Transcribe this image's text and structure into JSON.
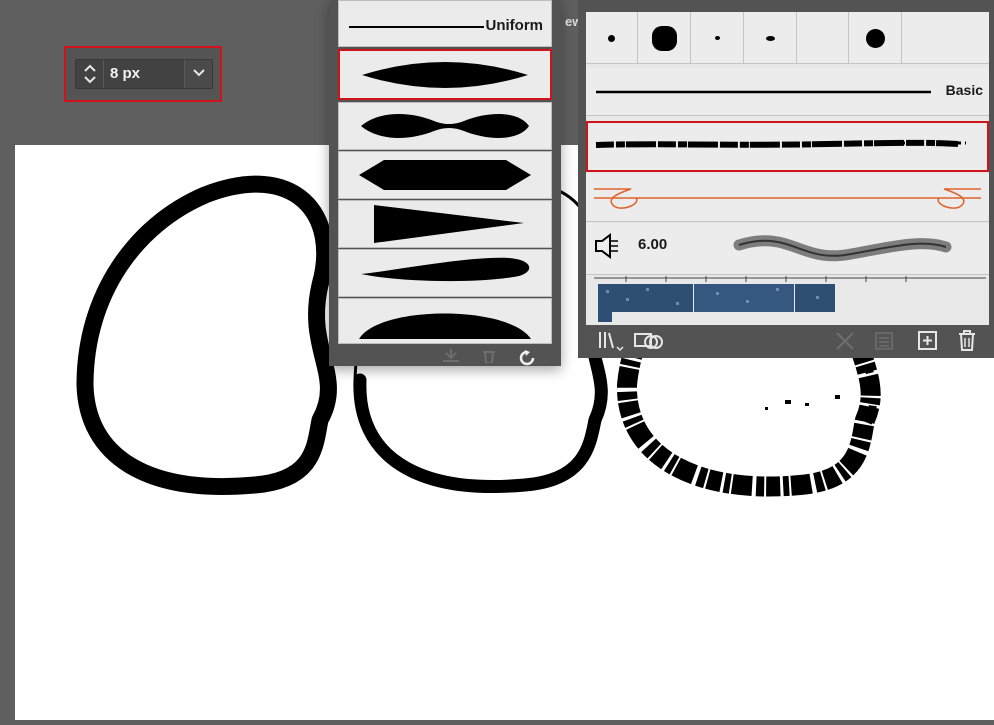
{
  "stroke": {
    "weight_value": "8 px"
  },
  "profile_panel": {
    "uniform_label": "Uniform",
    "profiles": [
      "uniform",
      "width-profile-1",
      "width-profile-2",
      "width-profile-3",
      "width-profile-4",
      "width-profile-5",
      "width-profile-6"
    ],
    "selected_index": 1
  },
  "brush_panel": {
    "tab_fragment": "ew",
    "basic_label": "Basic",
    "bristle_size": "6.00",
    "selected_brush": "charcoal"
  },
  "colors": {
    "panel_bg": "#535353",
    "selection_red": "#d0121b",
    "art_brush_orange": "#e0622a"
  }
}
